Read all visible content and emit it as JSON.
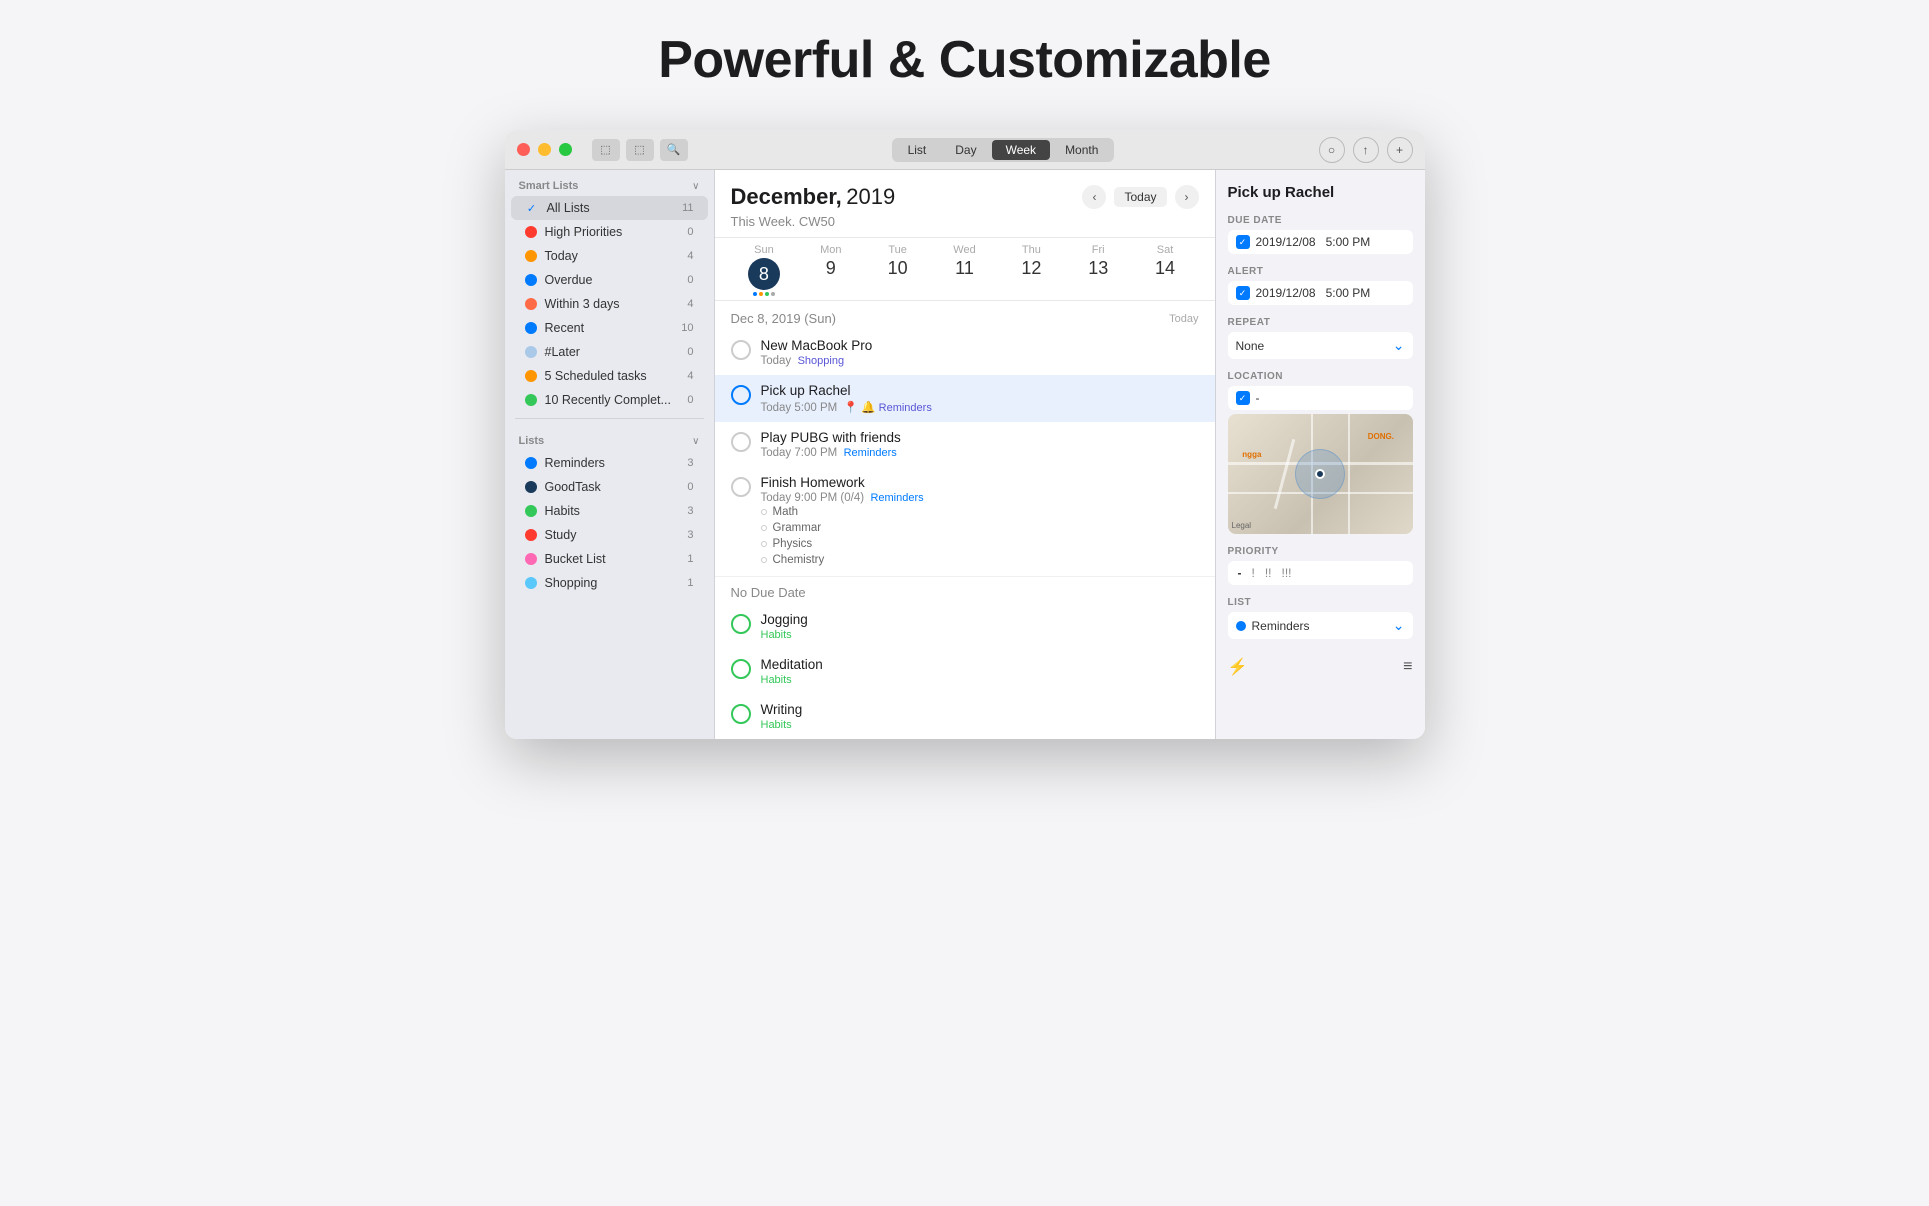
{
  "page": {
    "title": "Powerful & Customizable"
  },
  "titlebar": {
    "seg_list": "List",
    "seg_day": "Day",
    "seg_week": "Week",
    "seg_month": "Month"
  },
  "sidebar": {
    "smart_lists_label": "Smart Lists",
    "lists_label": "Lists",
    "smart_items": [
      {
        "id": "all-lists",
        "label": "All Lists",
        "count": "11",
        "color": "#007aff",
        "icon": "check"
      },
      {
        "id": "high-priorities",
        "label": "High Priorities",
        "count": "0",
        "color": "#ff3b30",
        "icon": "dot"
      },
      {
        "id": "today",
        "label": "Today",
        "count": "4",
        "color": "#ff9500",
        "icon": "dot"
      },
      {
        "id": "overdue",
        "label": "Overdue",
        "count": "0",
        "color": "#007aff",
        "icon": "dot"
      },
      {
        "id": "within-3-days",
        "label": "Within 3 days",
        "count": "4",
        "color": "#ff6b47",
        "icon": "dot"
      },
      {
        "id": "recent",
        "label": "Recent",
        "count": "10",
        "color": "#007aff",
        "icon": "dot"
      },
      {
        "id": "later",
        "label": "#Later",
        "count": "0",
        "color": "#aac8e8",
        "icon": "dot"
      },
      {
        "id": "scheduled",
        "label": "5 Scheduled tasks",
        "count": "4",
        "color": "#ff9500",
        "icon": "dot"
      },
      {
        "id": "recently-complete",
        "label": "10 Recently Complet...",
        "count": "0",
        "color": "#34c759",
        "icon": "dot-check"
      }
    ],
    "list_items": [
      {
        "id": "reminders",
        "label": "Reminders",
        "count": "3",
        "color": "#007aff"
      },
      {
        "id": "goodtask",
        "label": "GoodTask",
        "count": "0",
        "color": "#1a3a5c"
      },
      {
        "id": "habits",
        "label": "Habits",
        "count": "3",
        "color": "#34c759"
      },
      {
        "id": "study",
        "label": "Study",
        "count": "3",
        "color": "#ff3b30"
      },
      {
        "id": "bucket-list",
        "label": "Bucket List",
        "count": "1",
        "color": "#ff69b4"
      },
      {
        "id": "shopping",
        "label": "Shopping",
        "count": "1",
        "color": "#5ac8fa"
      }
    ]
  },
  "calendar": {
    "month_bold": "December,",
    "year": "2019",
    "subtitle": "This Week. CW50",
    "today_btn": "Today",
    "days": [
      {
        "name": "Sun",
        "num": "8",
        "today": true
      },
      {
        "name": "Mon",
        "num": "9",
        "today": false
      },
      {
        "name": "Tue",
        "num": "10",
        "today": false
      },
      {
        "name": "Wed",
        "num": "11",
        "today": false
      },
      {
        "name": "Thu",
        "num": "12",
        "today": false
      },
      {
        "name": "Fri",
        "num": "13",
        "today": false
      },
      {
        "name": "Sat",
        "num": "14",
        "today": false
      }
    ],
    "date_section_title": "Dec 8, 2019 (Sun)",
    "date_section_right": "Today",
    "no_due_label": "No Due Date"
  },
  "tasks": {
    "items": [
      {
        "id": "new-macbook",
        "name": "New MacBook Pro",
        "meta": "Today  Shopping",
        "tag": "Shopping",
        "tag_color": "purple",
        "selected": false
      },
      {
        "id": "pick-up-rachel",
        "name": "Pick up Rachel",
        "meta": "Today 5:00 PM",
        "tag": "Reminders",
        "tag_color": "purple",
        "selected": true
      },
      {
        "id": "play-pubg",
        "name": "Play PUBG with friends",
        "meta": "Today 7:00 PM",
        "tag": "Reminders",
        "tag_color": "blue",
        "selected": false
      },
      {
        "id": "finish-homework",
        "name": "Finish Homework",
        "meta": "Today 9:00 PM (0/4)",
        "tag": "Reminders",
        "tag_color": "blue",
        "selected": false,
        "subtasks": [
          "Math",
          "Grammar",
          "Physics",
          "Chemistry"
        ]
      }
    ],
    "no_due_items": [
      {
        "id": "jogging",
        "name": "Jogging",
        "tag": "Habits",
        "tag_color": "green"
      },
      {
        "id": "meditation",
        "name": "Meditation",
        "tag": "Habits",
        "tag_color": "green"
      },
      {
        "id": "writing",
        "name": "Writing",
        "tag": "Habits",
        "tag_color": "green"
      }
    ]
  },
  "detail": {
    "title": "Pick up Rachel",
    "due_date_label": "Due Date",
    "due_date_val": "2019/12/08",
    "due_date_time": "5:00 PM",
    "alert_label": "Alert",
    "alert_date": "2019/12/08",
    "alert_time": "5:00 PM",
    "repeat_label": "Repeat",
    "repeat_val": "None",
    "location_label": "Location",
    "location_val": "-",
    "map_label1": "ngga",
    "map_label2": "DONG.",
    "map_legal": "Legal",
    "priority_label": "Priority",
    "priority_none": "-",
    "priority_low": "!",
    "priority_med": "!!",
    "priority_high": "!!!",
    "list_label": "List",
    "list_val": "Reminders"
  }
}
